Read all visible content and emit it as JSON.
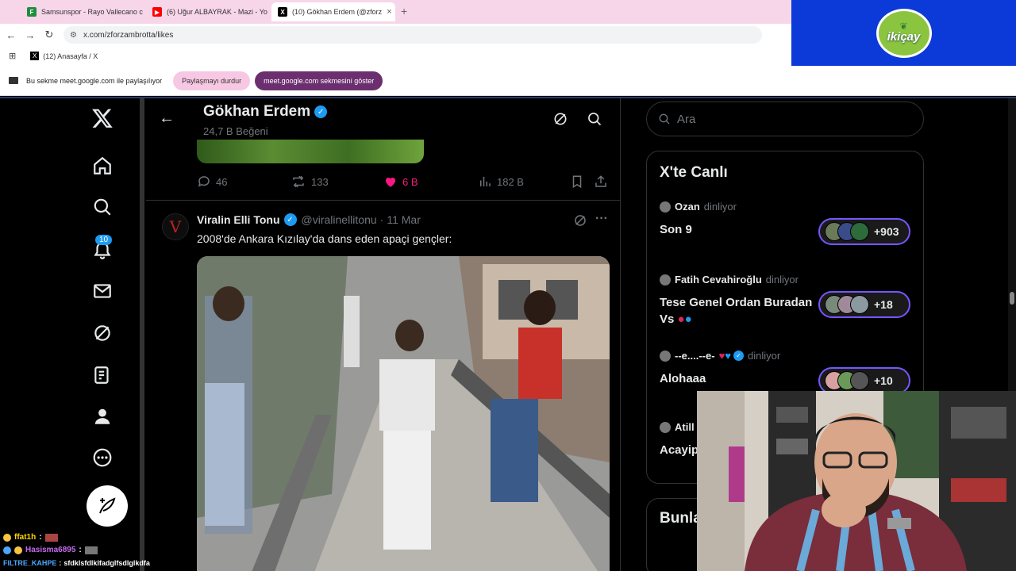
{
  "browser": {
    "tabs": [
      {
        "title": "Samsunspor - Rayo Vallecano c",
        "favicon": "sheets-icon",
        "color": "#1e8e3e"
      },
      {
        "title": "(6) Uğur ALBAYRAK - Mazi - Yo",
        "favicon": "youtube-icon",
        "color": "#ff0000"
      },
      {
        "title": "(10) Gökhan Erdem (@zforz",
        "favicon": "x-icon",
        "color": "#000000"
      }
    ],
    "address": "x.com/zforzambrotta/likes",
    "bookmark": "(12) Anasayfa / X"
  },
  "logo": {
    "text": "ikiçay",
    "bg": "#0b3ad8"
  },
  "share_bar": {
    "message": "Bu sekme meet.google.com ile paylaşılıyor",
    "stop_label": "Paylaşmayı durdur",
    "show_label": "meet.google.com sekmesini göster"
  },
  "left_nav": {
    "notifications_badge": "10",
    "items": [
      "x-logo-icon",
      "home-icon",
      "search-icon",
      "notifications-icon",
      "messages-icon",
      "grok-icon",
      "lists-icon",
      "profile-icon",
      "more-icon"
    ]
  },
  "header": {
    "name": "Gökhan Erdem",
    "likes_count": "24,7 B Beğeni"
  },
  "prev_tweet": {
    "replies": "46",
    "reposts": "133",
    "likes": "6 B",
    "views": "182 B"
  },
  "tweet": {
    "avatar_letter": "V",
    "name": "Viralin Elli Tonu",
    "handle": "@viralinellitonu",
    "date": "11 Mar",
    "text": "2008'de Ankara Kızılay'da dans eden apaçi gençler:"
  },
  "right": {
    "search_placeholder": "Ara",
    "live_title": "X'te Canlı",
    "listening_label": "dinliyor",
    "spaces": [
      {
        "host": "Ozan",
        "title": "Son 9",
        "count": "+903"
      },
      {
        "host": "Fatih Cevahiroğlu",
        "title": "Tese Genel Ordan Buradan Vs",
        "count": "+18"
      },
      {
        "host": "--e....--e-",
        "title": "Alohaaa",
        "count": "+10"
      },
      {
        "host": "Atill",
        "title": "Acayip",
        "count": ""
      }
    ],
    "bunla_title": "Bunla"
  },
  "chat": [
    {
      "user": "ffat1h",
      "color": "#ffd700",
      "message": ""
    },
    {
      "user": "Hasisma6895",
      "color": "#c56cf0",
      "message": ""
    },
    {
      "user": "FILTRE_KAHPE",
      "color": "#4da6ff",
      "message": "sfdklsfdlklfadglfsdlglkdfa"
    }
  ]
}
